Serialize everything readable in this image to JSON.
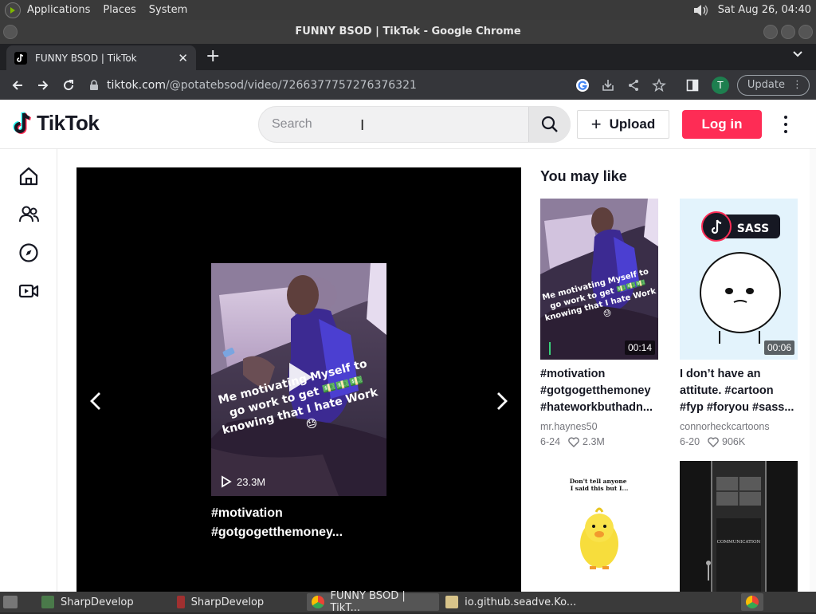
{
  "top_panel": {
    "applications": "Applications",
    "places": "Places",
    "system": "System",
    "clock": "Sat Aug 26, 04:40"
  },
  "window": {
    "title": "FUNNY BSOD | TikTok - Google Chrome"
  },
  "browser": {
    "tab_title": "FUNNY BSOD | TikTok",
    "url_host": "tiktok.com",
    "url_path": "/@potatebsod/video/7266377757276376321",
    "profile_initial": "T",
    "update_label": "Update"
  },
  "tiktok": {
    "logo_text": "TikTok",
    "search_placeholder": "Search",
    "upload_label": "Upload",
    "login_label": "Log in",
    "sidebar": [
      "home-icon",
      "following-icon",
      "explore-icon",
      "live-icon"
    ],
    "player": {
      "overlay_text": "Me motivating Myself to go work to get 💵💵💵 knowing that I hate Work 😓",
      "play_count": "23.3M",
      "caption_line1": "#motivation",
      "caption_line2": "#gotgogetthemoney..."
    },
    "you_may_like": "You may like",
    "suggestions": [
      {
        "duration": "00:14",
        "overlay": "Me motivating Myself to go work to get 💵💵💵 knowing that I hate Work 😓",
        "title_lines": [
          "#motivation",
          "#gotgogetthemoney",
          "#hateworkbuthadn..."
        ],
        "author": "mr.haynes50",
        "date": "6-24",
        "likes": "2.3M"
      },
      {
        "duration": "00:06",
        "overlay": "SASS",
        "title_lines": [
          "I don’t have an",
          "attitute. #cartoon",
          "#fyp #foryou #sass..."
        ],
        "author": "connorheckcartoons",
        "date": "6-20",
        "likes": "906K"
      },
      {
        "overlay": "Don't tell anyone I said this but I..."
      },
      {
        "overlay": "COMMUNICATION"
      }
    ]
  },
  "taskbar": {
    "items": [
      {
        "label": "SharpDevelop",
        "active": false
      },
      {
        "label": "SharpDevelop",
        "active": false
      },
      {
        "label": "FUNNY BSOD | TikT...",
        "active": true
      },
      {
        "label": "io.github.seadve.Ko...",
        "active": false
      }
    ]
  },
  "colors": {
    "accent": "#fe2c55",
    "text_primary": "#161823",
    "text_secondary": "#75767c"
  }
}
